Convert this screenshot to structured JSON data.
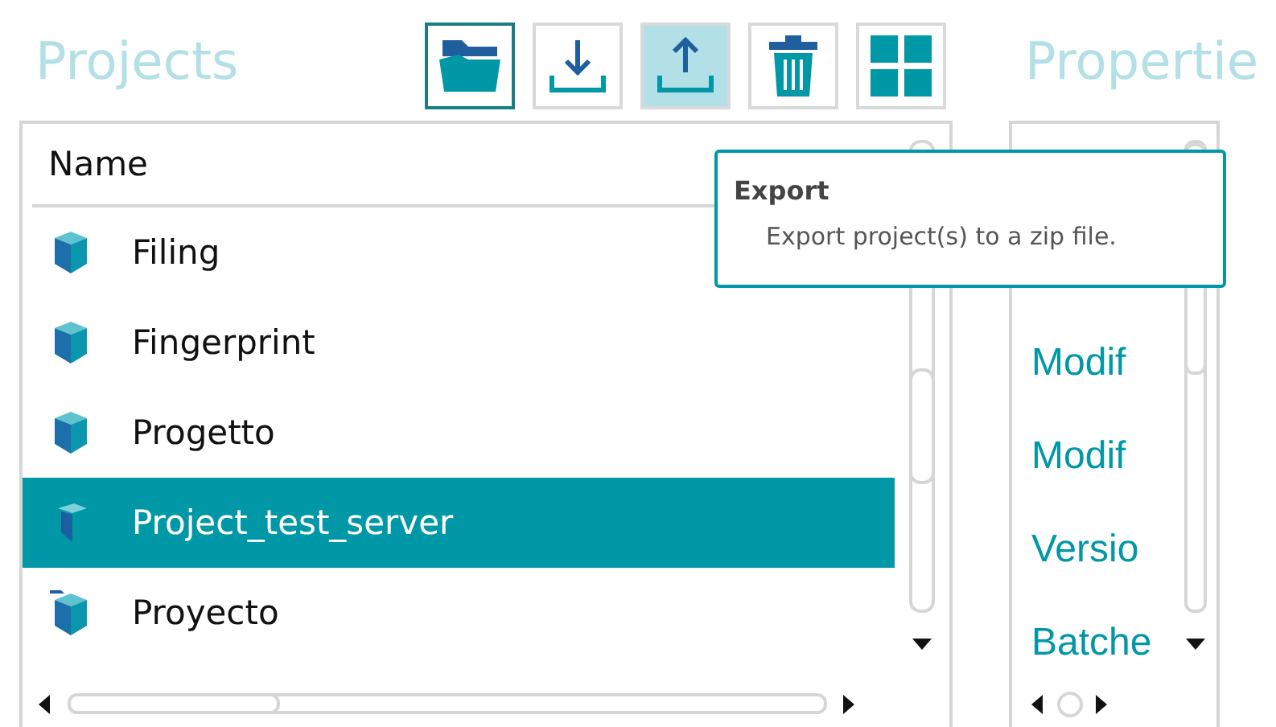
{
  "projects_panel": {
    "title": "Projects",
    "toolbar": [
      {
        "kind": "open",
        "focused": true,
        "hovered": false
      },
      {
        "kind": "import",
        "focused": false,
        "hovered": false
      },
      {
        "kind": "export",
        "focused": false,
        "hovered": true
      },
      {
        "kind": "delete",
        "focused": false,
        "hovered": false
      },
      {
        "kind": "tiles",
        "focused": false,
        "hovered": false
      }
    ],
    "list": {
      "column": "Name",
      "rows": [
        {
          "name": "Filing",
          "kind": "cube",
          "selected": false
        },
        {
          "name": "Fingerprint",
          "kind": "cube",
          "selected": false
        },
        {
          "name": "Progetto",
          "kind": "cube",
          "selected": false
        },
        {
          "name": "Project_test_server",
          "kind": "split",
          "selected": true
        },
        {
          "name": "Proyecto",
          "kind": "tagged",
          "selected": false
        }
      ]
    }
  },
  "properties_panel": {
    "title": "Propertie",
    "labels": [
      "Modif",
      "Modif",
      "Versio",
      "Batche"
    ]
  },
  "tooltip": {
    "title": "Export",
    "text": "Export project(s) to a zip file."
  }
}
